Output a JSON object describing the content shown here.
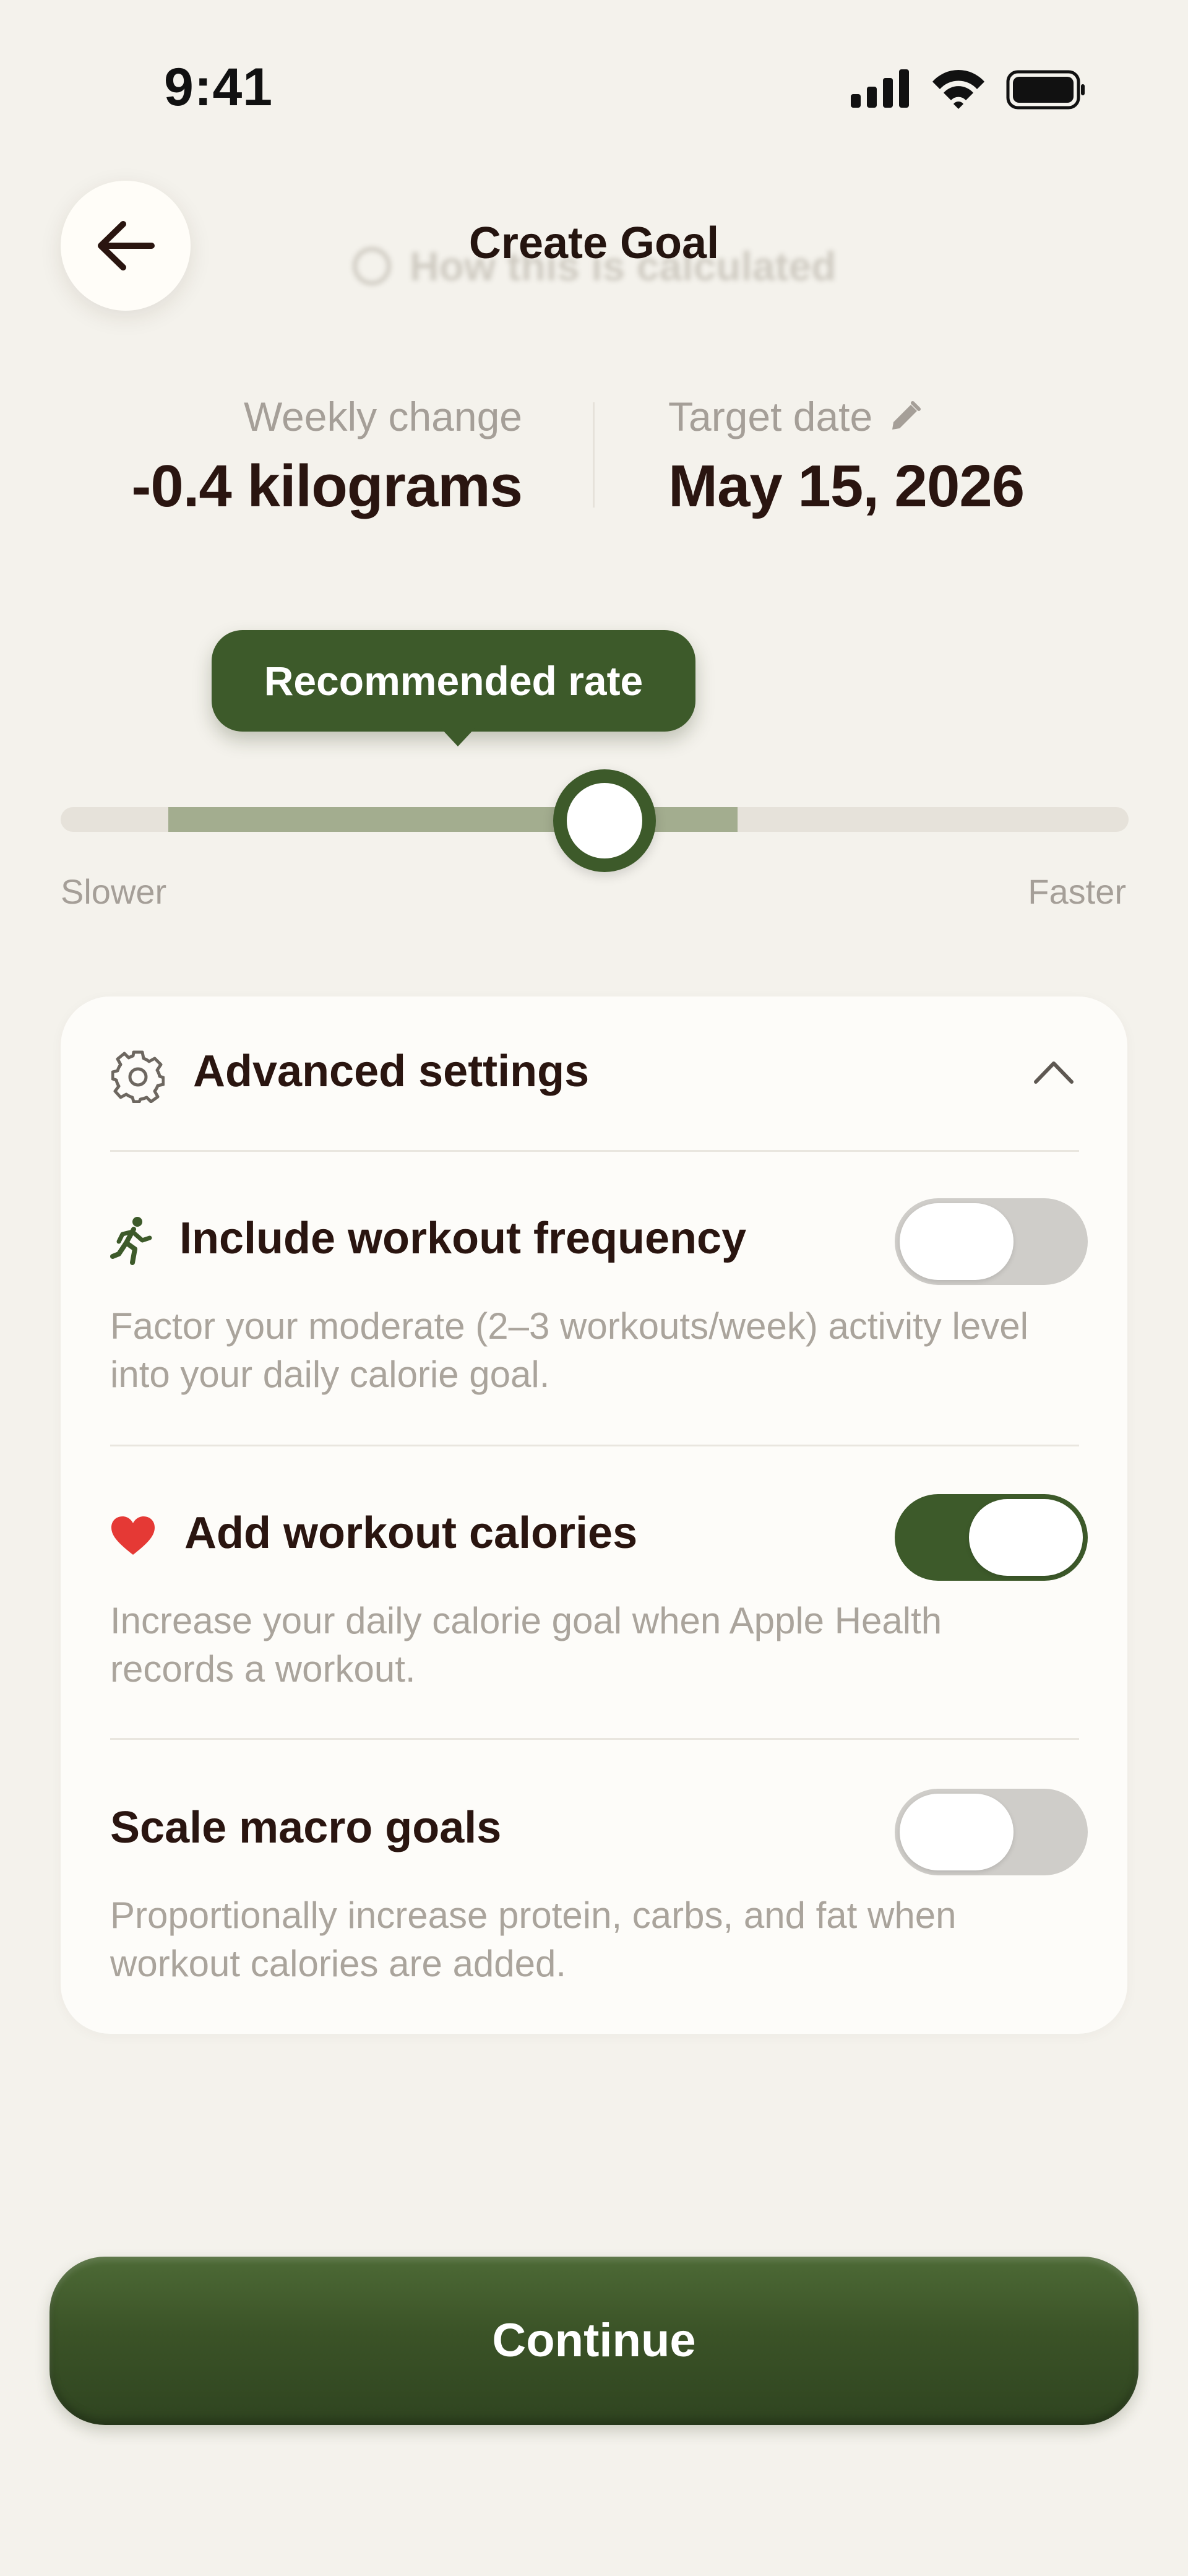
{
  "status_bar": {
    "time": "9:41",
    "icons": [
      "signal-icon",
      "wifi-icon",
      "battery-icon"
    ]
  },
  "header": {
    "title": "Create Goal",
    "back_icon": "arrow-left-icon",
    "background_text": "How this is calculated"
  },
  "stats": {
    "weekly_change_label": "Weekly change",
    "weekly_change_value": "-0.4 kilograms",
    "target_date_label": "Target date",
    "target_date_value": "May 15, 2026",
    "edit_icon": "pencil-icon"
  },
  "rate_slider": {
    "tooltip": "Recommended rate",
    "min_label": "Slower",
    "max_label": "Faster",
    "value_fraction": 0.51,
    "recommended_range_fraction": [
      0.1,
      0.63
    ]
  },
  "advanced_settings": {
    "title": "Advanced settings",
    "icon": "gear-icon",
    "expanded": true,
    "items": [
      {
        "icon": "running-person-icon",
        "title": "Include workout frequency",
        "description": "Factor your moderate (2–3 workouts/week) activity level into your daily calorie goal.",
        "enabled": false
      },
      {
        "icon": "heart-icon",
        "title": "Add workout calories",
        "description": "Increase your daily calorie goal when Apple Health records a workout.",
        "enabled": true
      },
      {
        "icon": "",
        "title": "Scale macro goals",
        "description": "Proportionally increase protein, carbs, and fat when workout calories are added.",
        "enabled": false
      }
    ]
  },
  "colors": {
    "accent": "#3d5a2a",
    "background": "#f4f2ec",
    "card": "#fdfcf9",
    "text_primary": "#2a1510",
    "text_secondary": "#a59f98",
    "heart": "#e53935"
  },
  "continue_button": {
    "label": "Continue"
  }
}
